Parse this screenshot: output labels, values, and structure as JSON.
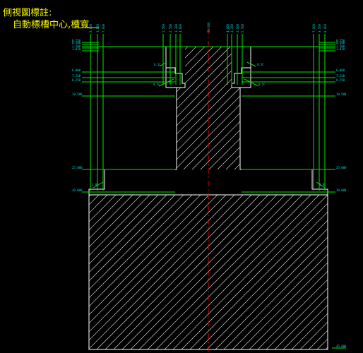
{
  "annotation": {
    "title": "側視圖標註:",
    "subtitle": "自動標槽中心,槽寬"
  },
  "colors": {
    "background": "#000000",
    "dimension": "#00e600",
    "text": "#00d8d8",
    "geometry": "#ffffff",
    "centerline": "#e00000",
    "title": "#f4f400"
  },
  "dim_top_left": [
    "8.000",
    "3.500",
    "7.000"
  ],
  "dim_top_center_left": [
    "5.500",
    "2.500",
    "3.300",
    "4.800"
  ],
  "dim_top_mid": [
    "20.000"
  ],
  "dim_top_center_right": [
    "4.800",
    "3.300",
    "2.500",
    "5.500"
  ],
  "dim_top_right": [
    "7.000",
    "3.500",
    "8.000"
  ],
  "dim_left_top": [
    "0.750",
    "0.500",
    "1.500",
    "1.870"
  ],
  "dim_right_top": [
    "0.750",
    "0.500",
    "1.500",
    "1.870"
  ],
  "dim_left_levels": [
    "6.000",
    "7.250",
    "8.250",
    "10.500",
    "25.000",
    "30.000"
  ],
  "dim_right_levels": [
    "6.000",
    "7.250",
    "8.250",
    "10.500",
    "25.000",
    "30.000"
  ],
  "chamfer_labels": [
    "0.5C",
    "0.5C",
    "0.5C",
    "0.5C",
    "1.0C",
    "1.0C"
  ],
  "bottom_value": "45.000"
}
